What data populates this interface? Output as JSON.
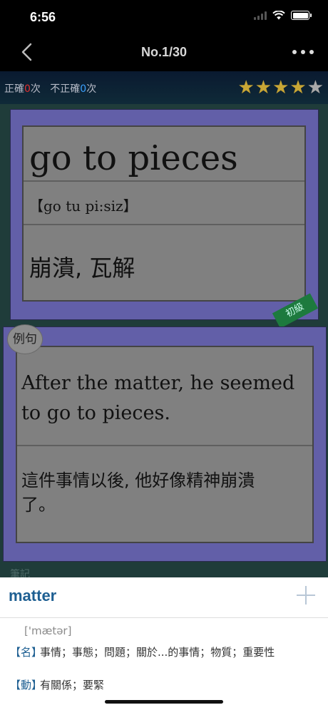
{
  "status": {
    "time": "6:56"
  },
  "nav": {
    "title": "No.1/30"
  },
  "score": {
    "correct_label": "正確",
    "correct_count": "0",
    "correct_unit": "次",
    "incorrect_label": "不正確",
    "incorrect_count": "0",
    "incorrect_unit": "次",
    "rating": 4,
    "rating_max": 5
  },
  "card": {
    "word": "go to pieces",
    "phonetic": "【go tu pi:siz】",
    "meaning": "崩潰, 瓦解",
    "level": "初級"
  },
  "example": {
    "badge": "例句",
    "english": "After the matter, he seemed to go to pieces.",
    "chinese": "這件事情以後, 他好像精神崩潰了。"
  },
  "notes_label": "筆記",
  "dictionary": {
    "headword": "matter",
    "ipa": "['mætər]",
    "entries": [
      {
        "pos": "【名】",
        "definition": "事情；事態；問題；關於...的事情；物質；重要性"
      },
      {
        "pos": "【動】",
        "definition": "有關係；要緊"
      }
    ]
  },
  "colors": {
    "card_border": "#625fa8",
    "level_badge": "#1d7a3e",
    "headword": "#1e5f92"
  }
}
